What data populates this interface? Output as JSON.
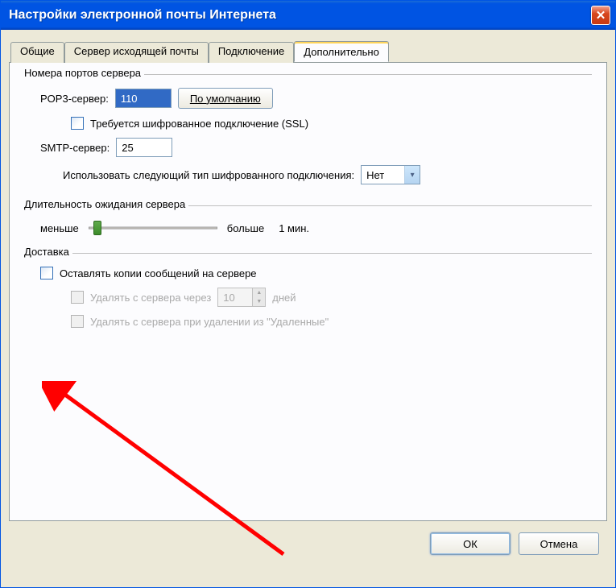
{
  "window": {
    "title": "Настройки электронной почты Интернета"
  },
  "tabs": {
    "general": "Общие",
    "outgoing": "Сервер исходящей почты",
    "connection": "Подключение",
    "advanced": "Дополнительно"
  },
  "groups": {
    "ports": "Номера портов сервера",
    "timeout": "Длительность ожидания сервера",
    "delivery": "Доставка"
  },
  "ports": {
    "pop3_label": "POP3-сервер:",
    "pop3_value": "110",
    "default_btn": "По умолчанию",
    "ssl_checkbox_label": "Требуется шифрованное подключение (SSL)",
    "smtp_label": "SMTP-сервер:",
    "smtp_value": "25",
    "encryption_label": "Использовать следующий тип шифрованного подключения:",
    "encryption_value": "Нет"
  },
  "timeout": {
    "less": "меньше",
    "more": "больше",
    "value": "1 мин."
  },
  "delivery": {
    "leave_copy": "Оставлять копии сообщений на сервере",
    "remove_after": "Удалять с сервера через",
    "remove_after_days_value": "10",
    "remove_after_days_unit": "дней",
    "remove_when_deleted": "Удалять с сервера при удалении из \"Удаленные\""
  },
  "buttons": {
    "ok": "ОК",
    "cancel": "Отмена"
  }
}
